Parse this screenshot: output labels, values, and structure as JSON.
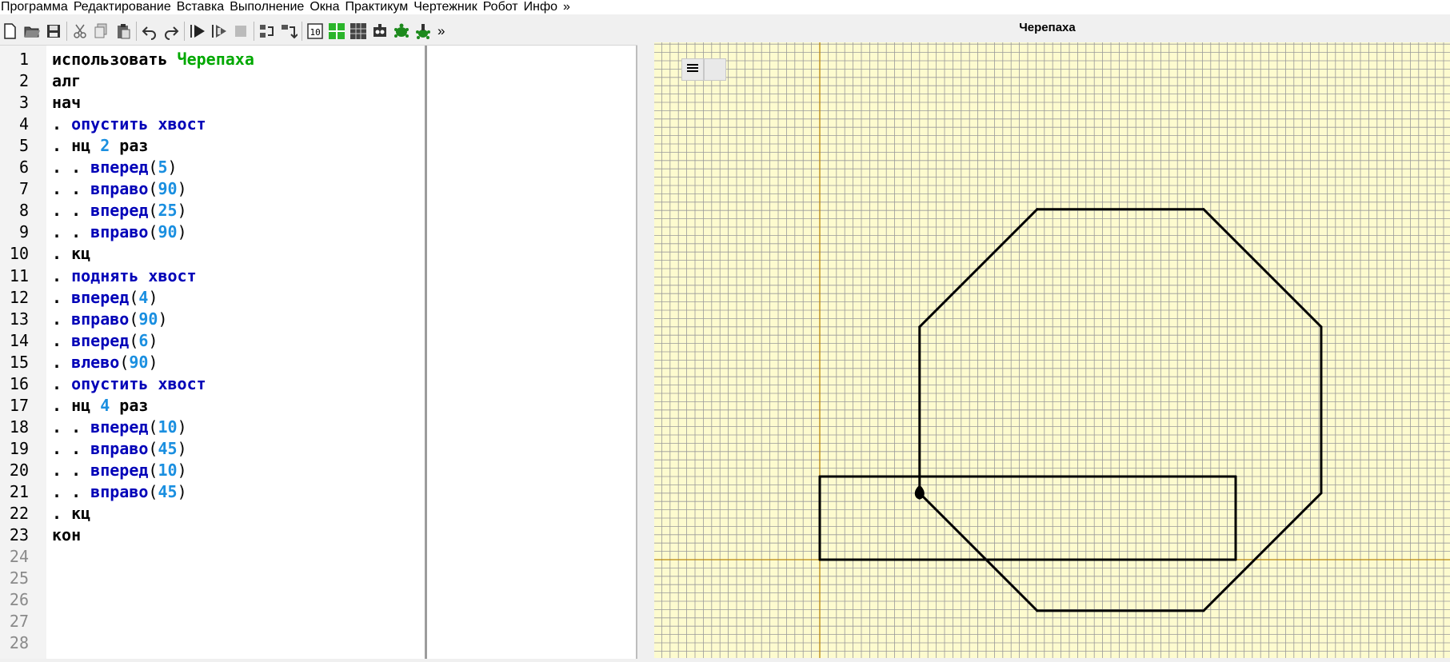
{
  "menu": [
    "Программа",
    "Редактирование",
    "Вставка",
    "Выполнение",
    "Окна",
    "Практикум",
    "Чертежник",
    "Робот",
    "Инфо",
    "»"
  ],
  "toolbar": {
    "icons": [
      "new-file-icon",
      "open-folder-icon",
      "save-icon",
      "cut-icon",
      "copy-icon",
      "paste-icon",
      "undo-icon",
      "redo-icon",
      "run-icon",
      "step-run-icon",
      "stop-icon",
      "step-over-icon",
      "step-into-icon",
      "counter-icon",
      "grid-green-icon",
      "grid-dark-icon",
      "robot-icon",
      "turtle-icon",
      "turtle-plant-icon"
    ],
    "more": "»"
  },
  "editor": {
    "lines": [
      {
        "n": "1",
        "tokens": [
          {
            "t": "использовать ",
            "c": "kw"
          },
          {
            "t": "Черепаха",
            "c": "mod"
          }
        ]
      },
      {
        "n": "2",
        "tokens": [
          {
            "t": "алг",
            "c": "kw"
          }
        ]
      },
      {
        "n": "3",
        "tokens": [
          {
            "t": "нач",
            "c": "kw"
          }
        ]
      },
      {
        "n": "4",
        "tokens": [
          {
            "t": ". ",
            "c": "kw"
          },
          {
            "t": "опустить хвост",
            "c": "cmd"
          }
        ]
      },
      {
        "n": "5",
        "tokens": [
          {
            "t": ". нц ",
            "c": "kw"
          },
          {
            "t": "2",
            "c": "num"
          },
          {
            "t": " раз",
            "c": "kw"
          }
        ]
      },
      {
        "n": "6",
        "tokens": [
          {
            "t": ". . ",
            "c": "kw"
          },
          {
            "t": "вперед",
            "c": "cmd"
          },
          {
            "t": "(",
            "c": "punc"
          },
          {
            "t": "5",
            "c": "num"
          },
          {
            "t": ")",
            "c": "punc"
          }
        ]
      },
      {
        "n": "7",
        "tokens": [
          {
            "t": ". . ",
            "c": "kw"
          },
          {
            "t": "вправо",
            "c": "cmd"
          },
          {
            "t": "(",
            "c": "punc"
          },
          {
            "t": "90",
            "c": "num"
          },
          {
            "t": ")",
            "c": "punc"
          }
        ]
      },
      {
        "n": "8",
        "tokens": [
          {
            "t": ". . ",
            "c": "kw"
          },
          {
            "t": "вперед",
            "c": "cmd"
          },
          {
            "t": "(",
            "c": "punc"
          },
          {
            "t": "25",
            "c": "num"
          },
          {
            "t": ")",
            "c": "punc"
          }
        ]
      },
      {
        "n": "9",
        "tokens": [
          {
            "t": ". . ",
            "c": "kw"
          },
          {
            "t": "вправо",
            "c": "cmd"
          },
          {
            "t": "(",
            "c": "punc"
          },
          {
            "t": "90",
            "c": "num"
          },
          {
            "t": ")",
            "c": "punc"
          }
        ]
      },
      {
        "n": "10",
        "tokens": [
          {
            "t": ". кц",
            "c": "kw"
          }
        ]
      },
      {
        "n": "11",
        "tokens": [
          {
            "t": ". ",
            "c": "kw"
          },
          {
            "t": "поднять хвост",
            "c": "cmd"
          }
        ]
      },
      {
        "n": "12",
        "tokens": [
          {
            "t": ". ",
            "c": "kw"
          },
          {
            "t": "вперед",
            "c": "cmd"
          },
          {
            "t": "(",
            "c": "punc"
          },
          {
            "t": "4",
            "c": "num"
          },
          {
            "t": ")",
            "c": "punc"
          }
        ]
      },
      {
        "n": "13",
        "tokens": [
          {
            "t": ". ",
            "c": "kw"
          },
          {
            "t": "вправо",
            "c": "cmd"
          },
          {
            "t": "(",
            "c": "punc"
          },
          {
            "t": "90",
            "c": "num"
          },
          {
            "t": ")",
            "c": "punc"
          }
        ]
      },
      {
        "n": "14",
        "tokens": [
          {
            "t": ". ",
            "c": "kw"
          },
          {
            "t": "вперед",
            "c": "cmd"
          },
          {
            "t": "(",
            "c": "punc"
          },
          {
            "t": "6",
            "c": "num"
          },
          {
            "t": ")",
            "c": "punc"
          }
        ]
      },
      {
        "n": "15",
        "tokens": [
          {
            "t": ". ",
            "c": "kw"
          },
          {
            "t": "влево",
            "c": "cmd"
          },
          {
            "t": "(",
            "c": "punc"
          },
          {
            "t": "90",
            "c": "num"
          },
          {
            "t": ")",
            "c": "punc"
          }
        ]
      },
      {
        "n": "16",
        "tokens": [
          {
            "t": ". ",
            "c": "kw"
          },
          {
            "t": "опустить хвост",
            "c": "cmd"
          }
        ]
      },
      {
        "n": "17",
        "tokens": [
          {
            "t": ". нц ",
            "c": "kw"
          },
          {
            "t": "4",
            "c": "num"
          },
          {
            "t": " раз",
            "c": "kw"
          }
        ]
      },
      {
        "n": "18",
        "tokens": [
          {
            "t": ". . ",
            "c": "kw"
          },
          {
            "t": "вперед",
            "c": "cmd"
          },
          {
            "t": "(",
            "c": "punc"
          },
          {
            "t": "10",
            "c": "num"
          },
          {
            "t": ")",
            "c": "punc"
          }
        ]
      },
      {
        "n": "19",
        "tokens": [
          {
            "t": ". . ",
            "c": "kw"
          },
          {
            "t": "вправо",
            "c": "cmd"
          },
          {
            "t": "(",
            "c": "punc"
          },
          {
            "t": "45",
            "c": "num"
          },
          {
            "t": ")",
            "c": "punc"
          }
        ]
      },
      {
        "n": "20",
        "tokens": [
          {
            "t": ". . ",
            "c": "kw"
          },
          {
            "t": "вперед",
            "c": "cmd"
          },
          {
            "t": "(",
            "c": "punc"
          },
          {
            "t": "10",
            "c": "num"
          },
          {
            "t": ")",
            "c": "punc"
          }
        ]
      },
      {
        "n": "21",
        "tokens": [
          {
            "t": ". . ",
            "c": "kw"
          },
          {
            "t": "вправо",
            "c": "cmd"
          },
          {
            "t": "(",
            "c": "punc"
          },
          {
            "t": "45",
            "c": "num"
          },
          {
            "t": ")",
            "c": "punc"
          }
        ]
      },
      {
        "n": "22",
        "tokens": [
          {
            "t": ". кц",
            "c": "kw"
          }
        ]
      },
      {
        "n": "23",
        "tokens": [
          {
            "t": "кон",
            "c": "kw"
          }
        ]
      },
      {
        "n": "24",
        "tokens": []
      },
      {
        "n": "25",
        "tokens": []
      },
      {
        "n": "26",
        "tokens": []
      },
      {
        "n": "27",
        "tokens": []
      },
      {
        "n": "28",
        "tokens": []
      }
    ]
  },
  "turtle_panel": {
    "title": "Черепаха",
    "menu_button_icon": "hamburger-menu-icon",
    "colors": {
      "background": "#fdfbcf",
      "grid": "#9a9a9a",
      "axis": "#b8860b",
      "path": "#000000",
      "turtle": "#000000"
    },
    "turtle_heading_deg": 0,
    "drawing": {
      "description_program": "pen down; repeat 2 (forward 5, right 90, forward 25, right 90); pen up; forward 4; right 90; forward 6; left 90; pen down; repeat 4 (forward 10, right 45, forward 10, right 45)"
    }
  }
}
